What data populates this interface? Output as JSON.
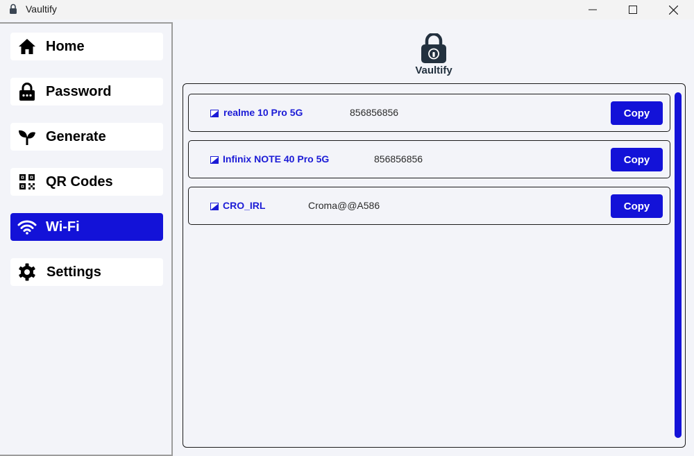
{
  "window": {
    "title": "Vaultify"
  },
  "sidebar": {
    "items": [
      {
        "label": "Home",
        "icon": "home-icon"
      },
      {
        "label": "Password",
        "icon": "lock-icon"
      },
      {
        "label": "Generate",
        "icon": "sprout-icon"
      },
      {
        "label": "QR Codes",
        "icon": "qr-code-icon"
      },
      {
        "label": "Wi-Fi",
        "icon": "wifi-icon",
        "active": true
      },
      {
        "label": "Settings",
        "icon": "gear-icon"
      }
    ]
  },
  "header": {
    "logo_text": "Vaultify"
  },
  "wifi": {
    "entries": [
      {
        "ssid": "realme 10 Pro 5G",
        "password": "856856856",
        "copy_label": "Copy"
      },
      {
        "ssid": "Infinix NOTE 40 Pro 5G",
        "password": "856856856",
        "copy_label": "Copy"
      },
      {
        "ssid": "CRO_IRL",
        "password": "Croma@@A586",
        "copy_label": "Copy"
      }
    ]
  },
  "colors": {
    "accent": "#1312d8",
    "background": "#f3f4f9"
  }
}
